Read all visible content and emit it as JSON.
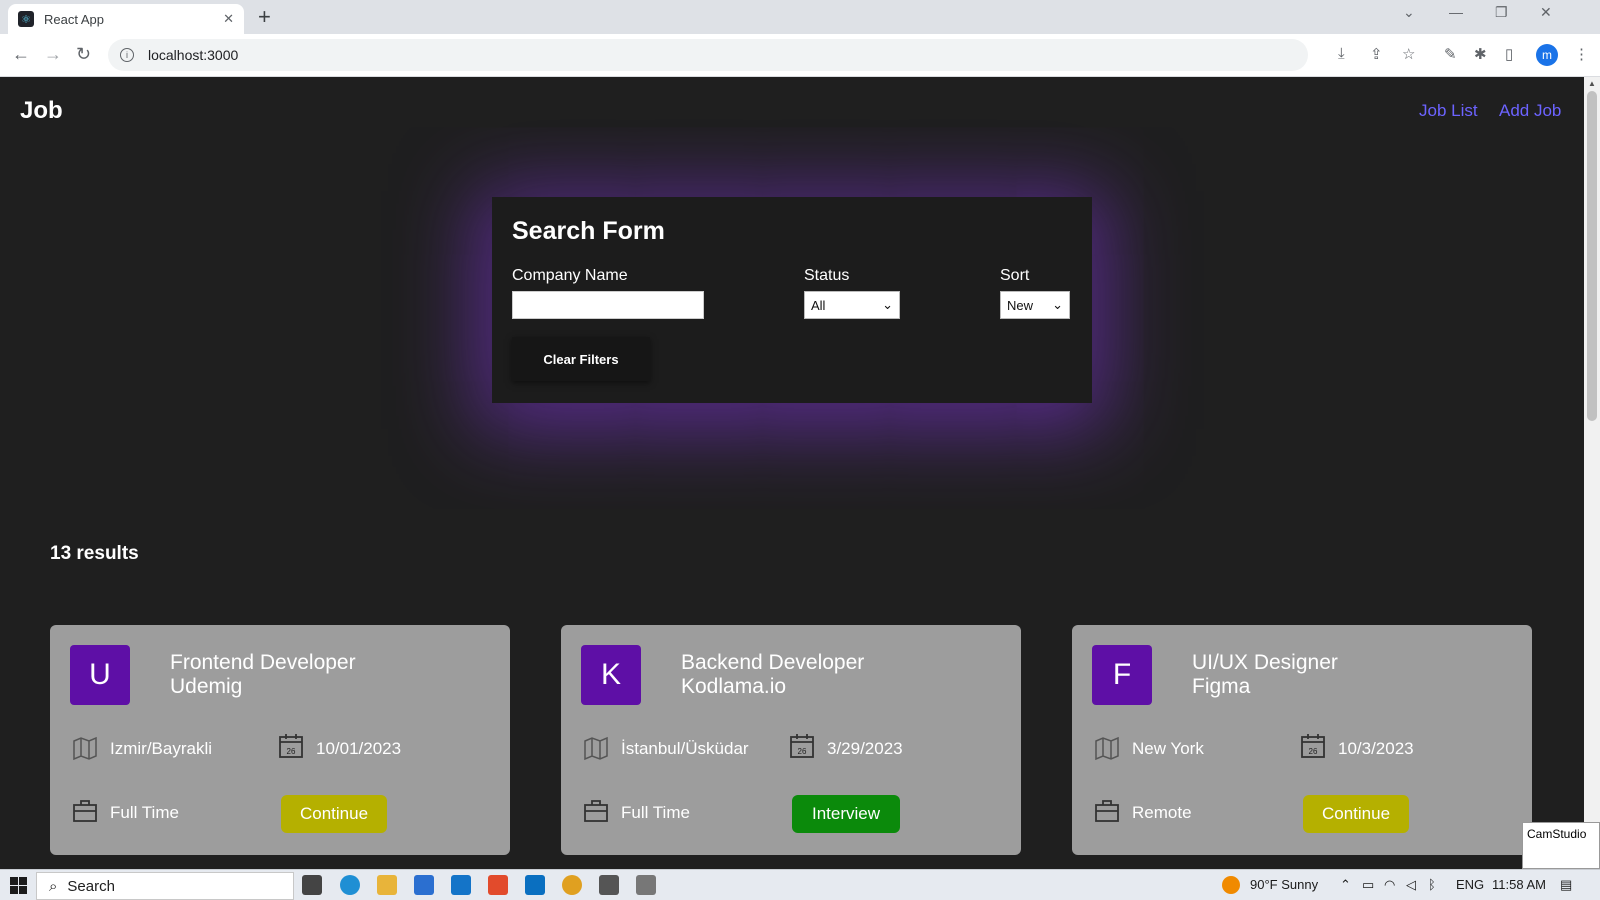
{
  "browser": {
    "tab_title": "React App",
    "tab_close": "✕",
    "new_tab": "+",
    "url": "localhost:3000",
    "profile_initial": "m",
    "icons": [
      "back-arrow-icon",
      "forward-arrow-icon",
      "reload-icon",
      "info-icon",
      "install-icon",
      "share-icon",
      "bookmark-star-icon",
      "extension-icon",
      "puzzle-icon",
      "sidepanel-icon",
      "menu-icon"
    ]
  },
  "header": {
    "brand": "Job",
    "links": [
      {
        "label": "Job List"
      },
      {
        "label": "Add Job"
      }
    ]
  },
  "search_form": {
    "title": "Search Form",
    "company_label": "Company Name",
    "company_value": "",
    "status_label": "Status",
    "status_value": "All",
    "sort_label": "Sort",
    "sort_value": "New",
    "clear_label": "Clear Filters"
  },
  "results_label": "13 results",
  "jobs": [
    {
      "initial": "U",
      "title": "Frontend Developer",
      "company": "Udemig",
      "location": "Izmir/Bayrakli",
      "date": "10/01/2023",
      "type": "Full Time",
      "status": "Continue",
      "status_color": "#b5b000"
    },
    {
      "initial": "K",
      "title": "Backend Developer",
      "company": "Kodlama.io",
      "location": "İstanbul/Üsküdar",
      "date": "3/29/2023",
      "type": "Full Time",
      "status": "Interview",
      "status_color": "#0b8a0b"
    },
    {
      "initial": "F",
      "title": "UI/UX Designer",
      "company": "Figma",
      "location": "New York",
      "date": "10/3/2023",
      "type": "Remote",
      "status": "Continue",
      "status_color": "#b5b000"
    }
  ],
  "calendar_day": "26",
  "colors": {
    "accent": "#6c63ff",
    "avatar": "#5e0fa6",
    "card": "#9d9d9d",
    "glow": "#7832c8"
  },
  "taskbar": {
    "search_label": "Search",
    "weather": "90°F  Sunny",
    "language": "ENG",
    "time": "11:58 AM",
    "camstudio": "CamStudio"
  }
}
